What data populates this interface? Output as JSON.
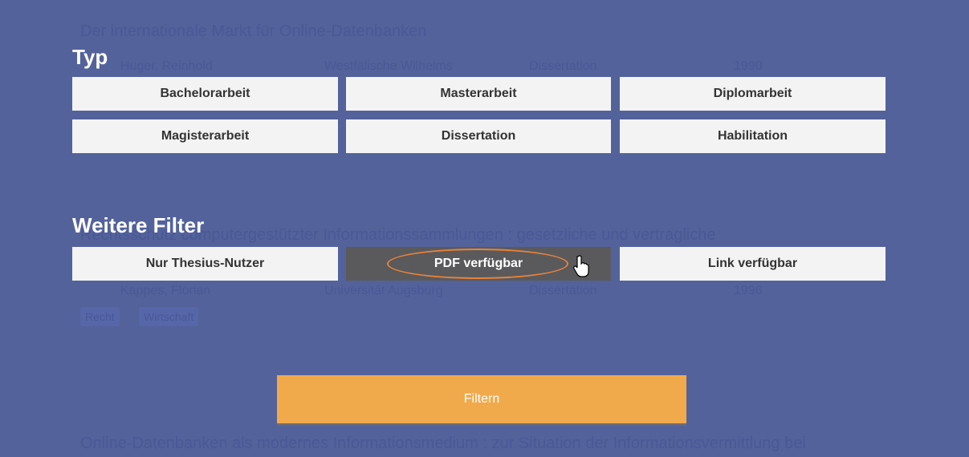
{
  "background_results": [
    {
      "title": "Der internationale Markt für Online-Datenbanken",
      "author": "Huger, Reinhold",
      "institution": "Westfälische Wilhelms",
      "type": "Dissertation",
      "year": "1990"
    },
    {
      "title": "Rechtsschutz computergestützter Informationssammlungen : gesetzliche und vertragliche",
      "author": "Kappes, Florian",
      "institution": "Universität Augsburg",
      "type": "Dissertation",
      "year": "1996",
      "tags": [
        "Recht",
        "Wirtschaft"
      ]
    },
    {
      "title": "Online-Datenbanken als modernes Informationsmedium : zur Situation der Informationsvermittlung bei"
    }
  ],
  "typ": {
    "heading": "Typ",
    "options": [
      "Bachelorarbeit",
      "Masterarbeit",
      "Diplomarbeit",
      "Magisterarbeit",
      "Dissertation",
      "Habilitation"
    ]
  },
  "weitere": {
    "heading": "Weitere Filter",
    "options": [
      "Nur Thesius-Nutzer",
      "PDF verfügbar",
      "Link verfügbar"
    ],
    "selected": "PDF verfügbar"
  },
  "filter_button": "Filtern",
  "colors": {
    "overlay": "#53629a",
    "accent": "#f0aa4c",
    "selected": "#5a5a5c",
    "highlight": "#e8833a"
  }
}
